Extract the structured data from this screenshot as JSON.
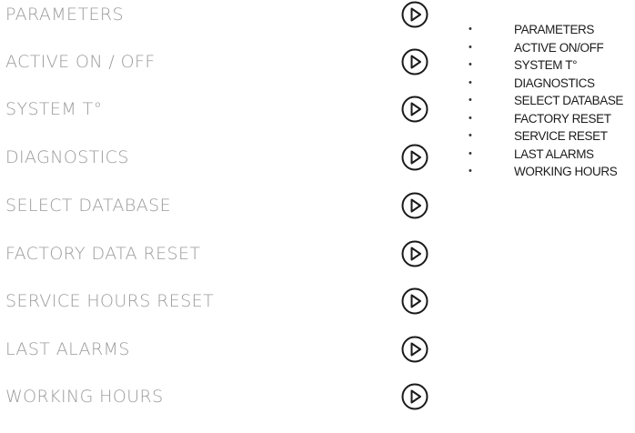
{
  "menu": {
    "items": [
      {
        "label": "PARAMETERS",
        "icon": "play-circle-icon"
      },
      {
        "label": "ACTIVE ON / OFF",
        "icon": "play-circle-icon"
      },
      {
        "label": "SYSTEM T°",
        "icon": "play-circle-icon"
      },
      {
        "label": "DIAGNOSTICS",
        "icon": "play-circle-icon"
      },
      {
        "label": "SELECT DATABASE",
        "icon": "play-circle-icon"
      },
      {
        "label": "FACTORY DATA RESET",
        "icon": "play-circle-icon"
      },
      {
        "label": "SERVICE HOURS RESET",
        "icon": "play-circle-icon"
      },
      {
        "label": "LAST ALARMS",
        "icon": "play-circle-icon"
      },
      {
        "label": "WORKING HOURS",
        "icon": "play-circle-icon"
      }
    ]
  },
  "summary": {
    "bullet": "•",
    "items": [
      "PARAMETERS",
      "ACTIVE ON/OFF",
      "SYSTEM T°",
      "DIAGNOSTICS",
      "SELECT DATABASE",
      "FACTORY RESET",
      "SERVICE RESET",
      "LAST ALARMS",
      "WORKING HOURS"
    ]
  },
  "colors": {
    "label_text": "#9b9b9b",
    "icon_stroke": "#1a1a1a",
    "summary_text": "#1c1c1c"
  }
}
